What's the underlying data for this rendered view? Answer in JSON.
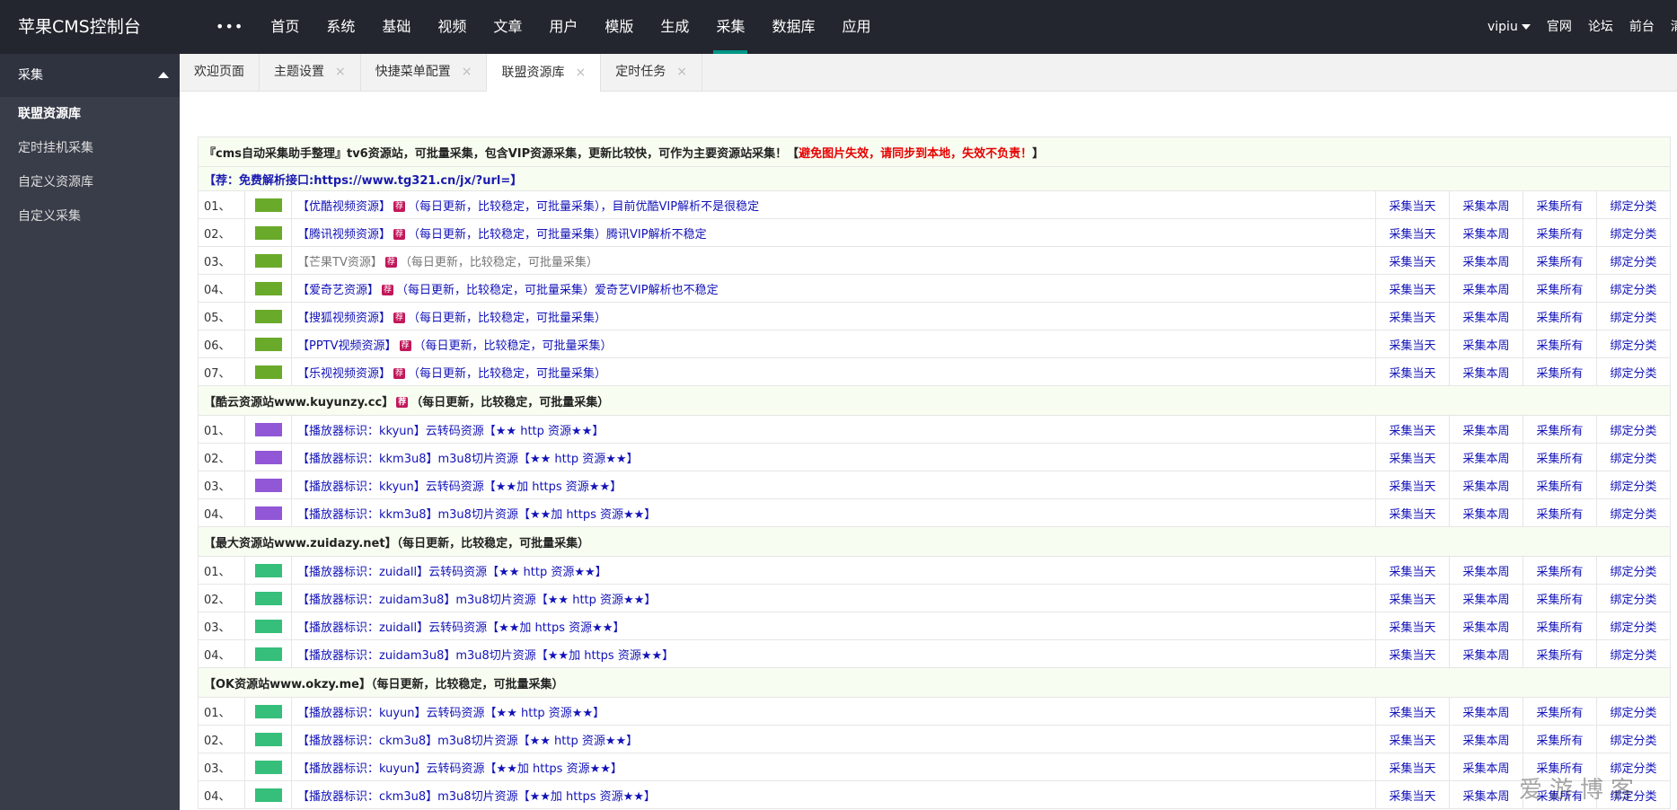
{
  "brand": "苹果CMS控制台",
  "mainnav": [
    "首页",
    "系统",
    "基础",
    "视频",
    "文章",
    "用户",
    "模版",
    "生成",
    "采集",
    "数据库",
    "应用"
  ],
  "mainnav_more": "•••",
  "active_nav": 8,
  "rightnav": {
    "user": "vipiu",
    "links": [
      "官网",
      "论坛",
      "前台",
      "清缓存"
    ]
  },
  "sidebar": {
    "head": "采集",
    "items": [
      "联盟资源库",
      "定时挂机采集",
      "自定义资源库",
      "自定义采集"
    ]
  },
  "tabs": [
    {
      "label": "欢迎页面",
      "closable": false
    },
    {
      "label": "主题设置",
      "closable": true
    },
    {
      "label": "快捷菜单配置",
      "closable": true
    },
    {
      "label": "联盟资源库",
      "closable": true,
      "active": true
    },
    {
      "label": "定时任务",
      "closable": true
    }
  ],
  "close_glyph": "×",
  "actions": [
    "采集当天",
    "采集本周",
    "采集所有",
    "绑定分类"
  ],
  "badge": "荐",
  "groups": [
    {
      "title": "『cms自动采集助手整理』tv6资源站，可批量采集，包含VIP资源采集，更新比较快，可作为主要资源站采集！【",
      "title_warn": "避免图片失效，请同步到本地，失效不负责！",
      "title_end": "】",
      "subtitle": "【荐：免费解析接口:https://www.tg321.cn/jx/?url=】",
      "color": "#6aaa2a",
      "rows": [
        {
          "num": "01、",
          "name": "【优酷视频资源】",
          "badge": true,
          "note": "（每日更新，比较稳定，可批量采集），目前优酷VIP解析不是很稳定"
        },
        {
          "num": "02、",
          "name": "【腾讯视频资源】",
          "badge": true,
          "note": "（每日更新，比较稳定，可批量采集）腾讯VIP解析不稳定"
        },
        {
          "num": "03、",
          "name": "【芒果TV资源】",
          "badge": true,
          "note": "（每日更新，比较稳定，可批量采集）",
          "gray": true
        },
        {
          "num": "04、",
          "name": "【爱奇艺资源】",
          "badge": true,
          "note": "（每日更新，比较稳定，可批量采集）爱奇艺VIP解析也不稳定"
        },
        {
          "num": "05、",
          "name": "【搜狐视频资源】",
          "badge": true,
          "note": "（每日更新，比较稳定，可批量采集）"
        },
        {
          "num": "06、",
          "name": "【PPTV视频资源】",
          "badge": true,
          "note": "（每日更新，比较稳定，可批量采集）"
        },
        {
          "num": "07、",
          "name": "【乐视视频资源】",
          "badge": true,
          "note": "（每日更新，比较稳定，可批量采集）"
        }
      ]
    },
    {
      "title": "【酷云资源站www.kuyunzy.cc】",
      "title_badge": true,
      "title_tail": "（每日更新，比较稳定，可批量采集）",
      "color": "#9257d6",
      "rows": [
        {
          "num": "01、",
          "name": "【播放器标识：kkyun】云转码资源【★★ http 资源★★】"
        },
        {
          "num": "02、",
          "name": "【播放器标识：kkm3u8】m3u8切片资源【★★ http 资源★★】"
        },
        {
          "num": "03、",
          "name": "【播放器标识：kkyun】云转码资源【★★加 https 资源★★】"
        },
        {
          "num": "04、",
          "name": "【播放器标识：kkm3u8】m3u8切片资源【★★加 https 资源★★】"
        }
      ]
    },
    {
      "title": "【最大资源站www.zuidazy.net】",
      "title_tail": "（每日更新，比较稳定，可批量采集）",
      "color": "#35bf7a",
      "rows": [
        {
          "num": "01、",
          "name": "【播放器标识：zuidall】云转码资源【★★ http 资源★★】"
        },
        {
          "num": "02、",
          "name": "【播放器标识：zuidam3u8】m3u8切片资源【★★ http 资源★★】"
        },
        {
          "num": "03、",
          "name": "【播放器标识：zuidall】云转码资源【★★加 https 资源★★】"
        },
        {
          "num": "04、",
          "name": "【播放器标识：zuidam3u8】m3u8切片资源【★★加 https 资源★★】"
        }
      ]
    },
    {
      "title": "【OK资源站www.okzy.me】",
      "title_tail": "（每日更新，比较稳定，可批量采集）",
      "color": "#35bf7a",
      "rows": [
        {
          "num": "01、",
          "name": "【播放器标识：kuyun】云转码资源【★★ http 资源★★】"
        },
        {
          "num": "02、",
          "name": "【播放器标识：ckm3u8】m3u8切片资源【★★ http 资源★★】"
        },
        {
          "num": "03、",
          "name": "【播放器标识：kuyun】云转码资源【★★加 https 资源★★】"
        },
        {
          "num": "04、",
          "name": "【播放器标识：ckm3u8】m3u8切片资源【★★加 https 资源★★】"
        }
      ]
    }
  ],
  "watermark": "爱游博客"
}
